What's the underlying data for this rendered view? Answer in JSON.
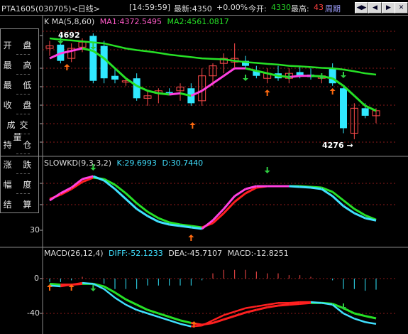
{
  "header": {
    "symbol": "PTA1605(030705)<日线>",
    "time": "[14:59:59]",
    "latest_label": "最新:",
    "latest_value": "4350",
    "change": "+0.00%",
    "open_label": "今开:",
    "open_value": "4330",
    "high_label": "最高:",
    "high_value": "43",
    "period": "周期"
  },
  "nav_buttons": [
    "◀▶",
    "◀",
    "▶",
    "✕"
  ],
  "left_panel": [
    "开 盘",
    "最 高",
    "最 低",
    "收 盘",
    "成交量",
    "持 仓",
    "涨 跌",
    "幅 度",
    "结 算"
  ],
  "main_panel": {
    "indicator": "K  MA(5,8,60)",
    "ma1_label": "MA1:4372.5495",
    "ma2_label": "MA2:4561.0817",
    "high_mark": "4692",
    "low_mark": "4276"
  },
  "kd_panel": {
    "indicator": "SLOWKD(9,3,3,2)",
    "k_label": "K:29.6993",
    "d_label": "D:30.7440",
    "axis_tick": "30"
  },
  "macd_panel": {
    "indicator": "MACD(26,12,4)",
    "diff_label": "DIFF:-52.1233",
    "dea_label": "DEA:-45.7107",
    "macd_label": "MACD:-12.8251",
    "axis_ticks": [
      "0",
      "-40"
    ]
  },
  "chart_data": [
    {
      "type": "candlestick",
      "title": "K  MA(5,8,60)",
      "candles": [
        {
          "o": 4640,
          "h": 4670,
          "l": 4610,
          "c": 4650,
          "color": "red"
        },
        {
          "o": 4655,
          "h": 4692,
          "l": 4580,
          "c": 4590,
          "color": "cyan"
        },
        {
          "o": 4600,
          "h": 4660,
          "l": 4585,
          "c": 4640,
          "color": "red"
        },
        {
          "o": 4645,
          "h": 4680,
          "l": 4625,
          "c": 4665,
          "color": "red"
        },
        {
          "o": 4690,
          "h": 4700,
          "l": 4500,
          "c": 4510,
          "color": "cyan"
        },
        {
          "o": 4650,
          "h": 4670,
          "l": 4500,
          "c": 4520,
          "color": "cyan"
        },
        {
          "o": 4530,
          "h": 4560,
          "l": 4500,
          "c": 4515,
          "color": "cyan"
        },
        {
          "o": 4505,
          "h": 4520,
          "l": 4490,
          "c": 4510,
          "color": "red"
        },
        {
          "o": 4520,
          "h": 4540,
          "l": 4430,
          "c": 4440,
          "color": "cyan"
        },
        {
          "o": 4440,
          "h": 4470,
          "l": 4410,
          "c": 4450,
          "color": "red"
        },
        {
          "o": 4460,
          "h": 4480,
          "l": 4420,
          "c": 4470,
          "color": "red"
        },
        {
          "o": 4465,
          "h": 4480,
          "l": 4455,
          "c": 4460,
          "color": "cyan"
        },
        {
          "o": 4470,
          "h": 4500,
          "l": 4430,
          "c": 4485,
          "color": "red"
        },
        {
          "o": 4480,
          "h": 4500,
          "l": 4410,
          "c": 4420,
          "color": "cyan"
        },
        {
          "o": 4430,
          "h": 4560,
          "l": 4410,
          "c": 4530,
          "color": "red"
        },
        {
          "o": 4530,
          "h": 4580,
          "l": 4490,
          "c": 4570,
          "color": "red"
        },
        {
          "o": 4580,
          "h": 4620,
          "l": 4540,
          "c": 4600,
          "color": "red"
        },
        {
          "o": 4600,
          "h": 4660,
          "l": 4560,
          "c": 4585,
          "color": "red"
        },
        {
          "o": 4590,
          "h": 4610,
          "l": 4560,
          "c": 4570,
          "color": "cyan"
        },
        {
          "o": 4550,
          "h": 4570,
          "l": 4520,
          "c": 4530,
          "color": "cyan"
        },
        {
          "o": 4520,
          "h": 4560,
          "l": 4500,
          "c": 4540,
          "color": "red"
        },
        {
          "o": 4540,
          "h": 4570,
          "l": 4510,
          "c": 4520,
          "color": "cyan"
        },
        {
          "o": 4520,
          "h": 4560,
          "l": 4500,
          "c": 4540,
          "color": "red"
        },
        {
          "o": 4545,
          "h": 4570,
          "l": 4520,
          "c": 4530,
          "color": "cyan"
        },
        {
          "o": 4535,
          "h": 4560,
          "l": 4515,
          "c": 4525,
          "color": "cyan"
        },
        {
          "o": 4520,
          "h": 4540,
          "l": 4500,
          "c": 4530,
          "color": "red"
        },
        {
          "o": 4560,
          "h": 4580,
          "l": 4490,
          "c": 4500,
          "color": "cyan"
        },
        {
          "o": 4480,
          "h": 4490,
          "l": 4300,
          "c": 4320,
          "color": "cyan"
        },
        {
          "o": 4300,
          "h": 4420,
          "l": 4276,
          "c": 4400,
          "color": "red"
        },
        {
          "o": 4400,
          "h": 4420,
          "l": 4360,
          "c": 4370,
          "color": "cyan"
        },
        {
          "o": 4370,
          "h": 4400,
          "l": 4340,
          "c": 4390,
          "color": "red"
        }
      ],
      "ma1": [
        4600,
        4620,
        4630,
        4640,
        4630,
        4600,
        4560,
        4520,
        4490,
        4470,
        4460,
        4455,
        4460,
        4450,
        4470,
        4500,
        4530,
        4560,
        4560,
        4550,
        4540,
        4530,
        4525,
        4530,
        4530,
        4528,
        4520,
        4490,
        4450,
        4410,
        4390
      ],
      "ma2": [
        4680,
        4675,
        4672,
        4668,
        4664,
        4660,
        4650,
        4640,
        4633,
        4628,
        4622,
        4615,
        4610,
        4605,
        4600,
        4598,
        4596,
        4590,
        4585,
        4582,
        4578,
        4575,
        4570,
        4568,
        4565,
        4562,
        4560,
        4555,
        4548,
        4540,
        4535
      ],
      "annotations": [
        "4692",
        "4276"
      ]
    },
    {
      "type": "line",
      "title": "SLOWKD(9,3,3,2)",
      "series": [
        {
          "name": "K",
          "values": [
            58,
            68,
            76,
            88,
            92,
            86,
            74,
            60,
            46,
            36,
            28,
            24,
            22,
            20,
            18,
            30,
            46,
            64,
            74,
            78,
            78,
            78,
            78,
            77,
            76,
            74,
            64,
            50,
            40,
            33,
            29.7
          ]
        },
        {
          "name": "D",
          "values": [
            60,
            66,
            74,
            84,
            90,
            88,
            80,
            68,
            54,
            42,
            33,
            27,
            24,
            22,
            20,
            26,
            40,
            56,
            68,
            76,
            78,
            78,
            78,
            78,
            77,
            76,
            70,
            58,
            46,
            37,
            30.7
          ]
        }
      ]
    },
    {
      "type": "bar+line",
      "title": "MACD(26,12,4)",
      "series": [
        {
          "name": "DIFF",
          "values": [
            -8,
            -9,
            -7,
            -5,
            -6,
            -12,
            -22,
            -30,
            -36,
            -40,
            -44,
            -48,
            -52,
            -55,
            -54,
            -48,
            -42,
            -38,
            -34,
            -32,
            -30,
            -28,
            -28,
            -27,
            -27,
            -28,
            -30,
            -40,
            -46,
            -50,
            -52.1
          ]
        },
        {
          "name": "DEA",
          "values": [
            -6,
            -7,
            -7,
            -6,
            -6,
            -9,
            -16,
            -24,
            -30,
            -36,
            -40,
            -44,
            -48,
            -51,
            -53,
            -51,
            -47,
            -43,
            -39,
            -36,
            -33,
            -31,
            -30,
            -29,
            -28,
            -28,
            -29,
            -34,
            -40,
            -43,
            -45.7
          ]
        },
        {
          "name": "MACD",
          "values": [
            -4,
            -4,
            -2,
            2,
            0,
            -6,
            -12,
            -12,
            -12,
            -8,
            -8,
            -8,
            -8,
            -8,
            -2,
            6,
            10,
            10,
            10,
            8,
            6,
            6,
            4,
            4,
            2,
            0,
            -2,
            -12,
            -12,
            -14,
            -12.8
          ]
        }
      ]
    }
  ]
}
